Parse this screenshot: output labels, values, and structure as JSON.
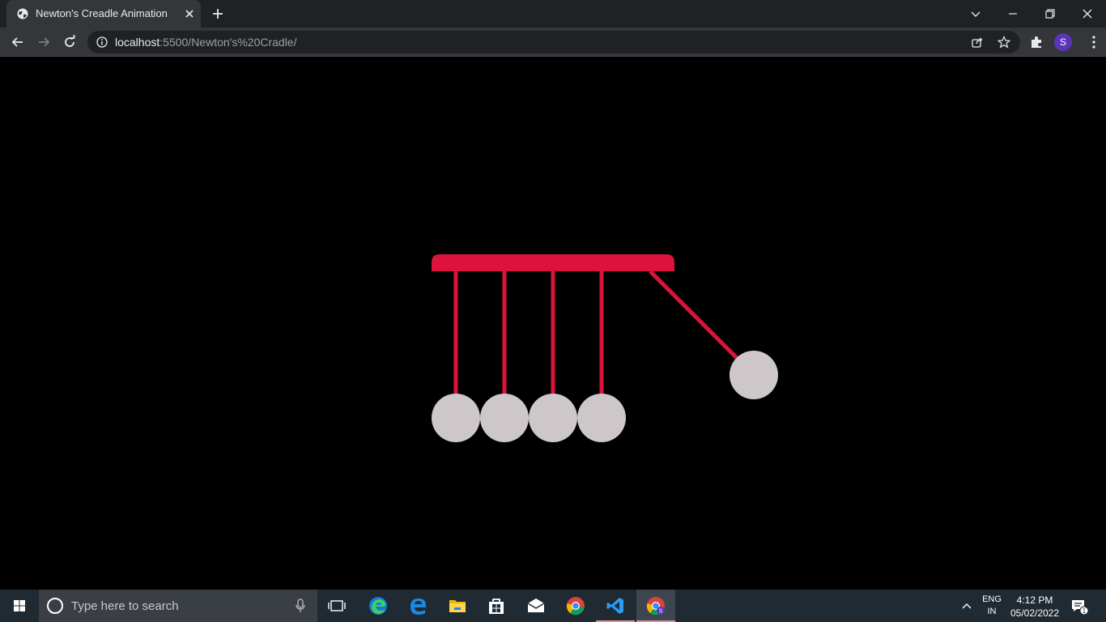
{
  "browser": {
    "tab": {
      "title": "Newton's Creadle Animation"
    },
    "address": {
      "host": "localhost",
      "path": ":5500/Newton's%20Cradle/"
    },
    "profile_initial": "S"
  },
  "page": {
    "colors": {
      "background": "#000000",
      "frame": "#dc143c",
      "ball": "#cdc7c9"
    },
    "cradle": {
      "ball_count": 5,
      "swinging_ball_index": 4,
      "swing_angle_degrees": 45
    }
  },
  "taskbar": {
    "search_placeholder": "Type here to search",
    "apps": [
      "task-view",
      "edge",
      "edge-legacy",
      "file-explorer",
      "microsoft-store",
      "mail",
      "chrome",
      "vscode",
      "chrome-profile"
    ],
    "tray": {
      "lang_primary": "ENG",
      "lang_secondary": "IN",
      "time": "4:12 PM",
      "date": "05/02/2022",
      "notifications": "1"
    }
  }
}
